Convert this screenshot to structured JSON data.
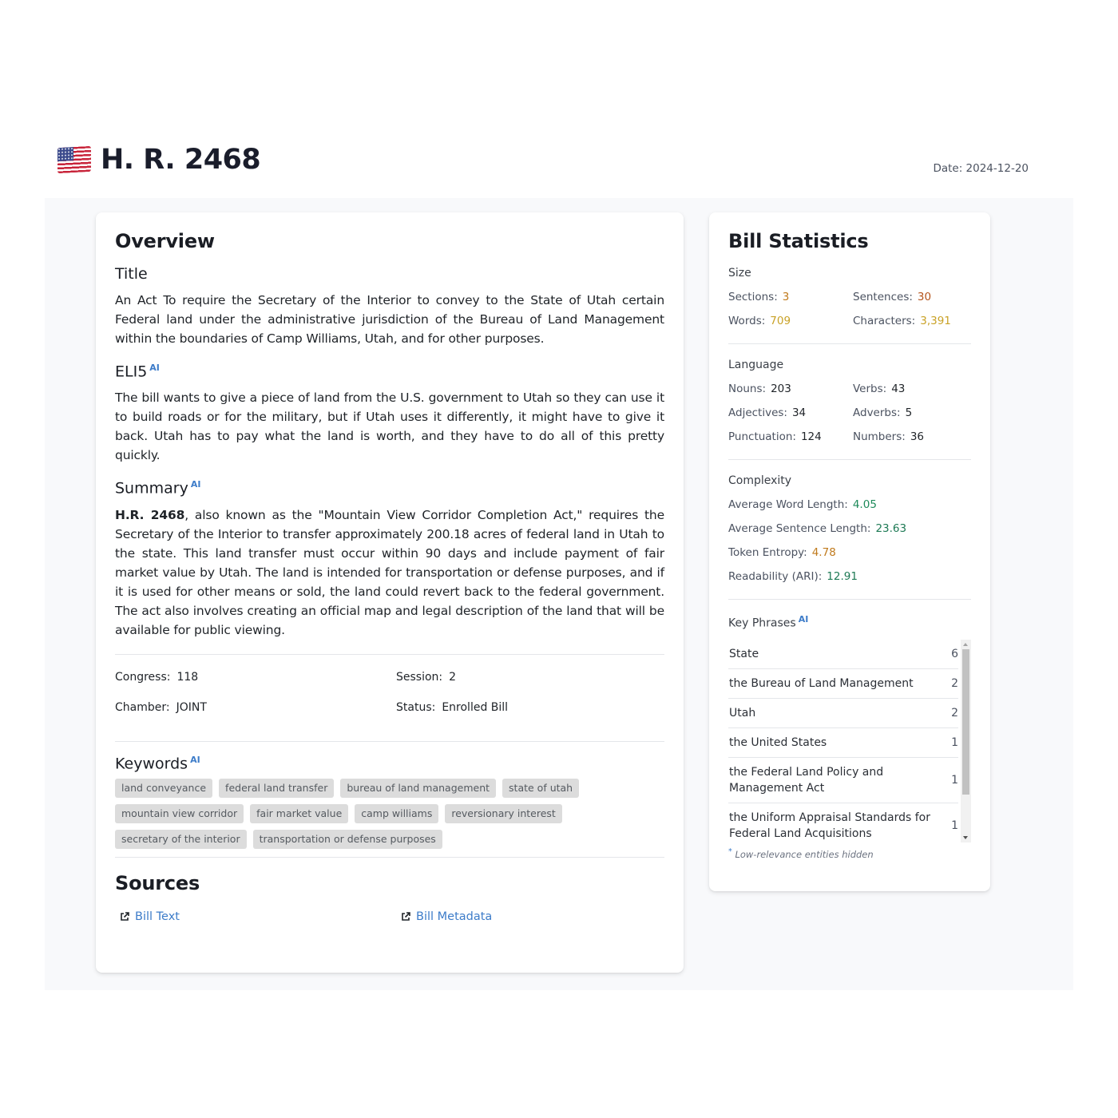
{
  "header": {
    "flag_icon": "us-flag-icon",
    "title": "H. R. 2468",
    "date_label": "Date: 2024-12-20"
  },
  "overview": {
    "heading": "Overview",
    "title_heading": "Title",
    "title_text": "An Act To require the Secretary of the Interior to convey to the State of Utah certain Federal land under the administrative jurisdiction of the Bureau of Land Management within the boundaries of Camp Williams, Utah, and for other purposes.",
    "eli5_heading": "ELI5",
    "ai_badge": "AI",
    "eli5_text": "The bill wants to give a piece of land from the U.S. government to Utah so they can use it to build roads or for the military, but if Utah uses it differently, it might have to give it back. Utah has to pay what the land is worth, and they have to do all of this pretty quickly.",
    "summary_heading": "Summary",
    "summary_bold": "H.R. 2468",
    "summary_text": ", also known as the \"Mountain View Corridor Completion Act,\" requires the Secretary of the Interior to transfer approximately 200.18 acres of federal land in Utah to the state. This land transfer must occur within 90 days and include payment of fair market value by Utah. The land is intended for transportation or defense purposes, and if it is used for other means or sold, the land could revert back to the federal government. The act also involves creating an official map and legal description of the land that will be available for public viewing.",
    "meta": {
      "congress_label": "Congress:",
      "congress_value": "118",
      "session_label": "Session:",
      "session_value": "2",
      "chamber_label": "Chamber:",
      "chamber_value": "JOINT",
      "status_label": "Status:",
      "status_value": "Enrolled Bill"
    },
    "keywords_heading": "Keywords",
    "keywords": [
      "land conveyance",
      "federal land transfer",
      "bureau of land management",
      "state of utah",
      "mountain view corridor",
      "fair market value",
      "camp williams",
      "reversionary interest",
      "secretary of the interior",
      "transportation or defense purposes"
    ],
    "sources_heading": "Sources",
    "sources": [
      {
        "label": "Bill Text",
        "icon": "external-link-icon"
      },
      {
        "label": "Bill Metadata",
        "icon": "external-link-icon"
      }
    ]
  },
  "stats": {
    "heading": "Bill Statistics",
    "size": {
      "title": "Size",
      "items": [
        {
          "label": "Sections:",
          "value": "3",
          "color": "#c07a1c"
        },
        {
          "label": "Sentences:",
          "value": "30",
          "color": "#b5541c"
        },
        {
          "label": "Words:",
          "value": "709",
          "color": "#c9a227"
        },
        {
          "label": "Characters:",
          "value": "3,391",
          "color": "#c9a227"
        }
      ]
    },
    "language": {
      "title": "Language",
      "items": [
        {
          "label": "Nouns:",
          "value": "203",
          "color": "#1f2328"
        },
        {
          "label": "Verbs:",
          "value": "43",
          "color": "#1f2328"
        },
        {
          "label": "Adjectives:",
          "value": "34",
          "color": "#1f2328"
        },
        {
          "label": "Adverbs:",
          "value": "5",
          "color": "#1f2328"
        },
        {
          "label": "Punctuation:",
          "value": "124",
          "color": "#1f2328"
        },
        {
          "label": "Numbers:",
          "value": "36",
          "color": "#1f2328"
        }
      ]
    },
    "complexity": {
      "title": "Complexity",
      "items": [
        {
          "label": "Average Word Length:",
          "value": "4.05",
          "color": "#1e8a5a"
        },
        {
          "label": "Average Sentence Length:",
          "value": "23.63",
          "color": "#1e7a55"
        },
        {
          "label": "Token Entropy:",
          "value": "4.78",
          "color": "#c07a1c"
        },
        {
          "label": "Readability (ARI):",
          "value": "12.91",
          "color": "#1e7a55"
        }
      ]
    },
    "key_phrases": {
      "title": "Key Phrases",
      "ai_badge": "AI",
      "items": [
        {
          "phrase": "State",
          "count": "6"
        },
        {
          "phrase": "the Bureau of Land Management",
          "count": "2"
        },
        {
          "phrase": "Utah",
          "count": "2"
        },
        {
          "phrase": "the United States",
          "count": "1"
        },
        {
          "phrase": "the Federal Land Policy and Management Act",
          "count": "1"
        },
        {
          "phrase": "the Uniform Appraisal Standards for Federal Land Acquisitions",
          "count": "1"
        }
      ],
      "footnote_mark": "*",
      "footnote": "Low-relevance entities hidden"
    }
  }
}
